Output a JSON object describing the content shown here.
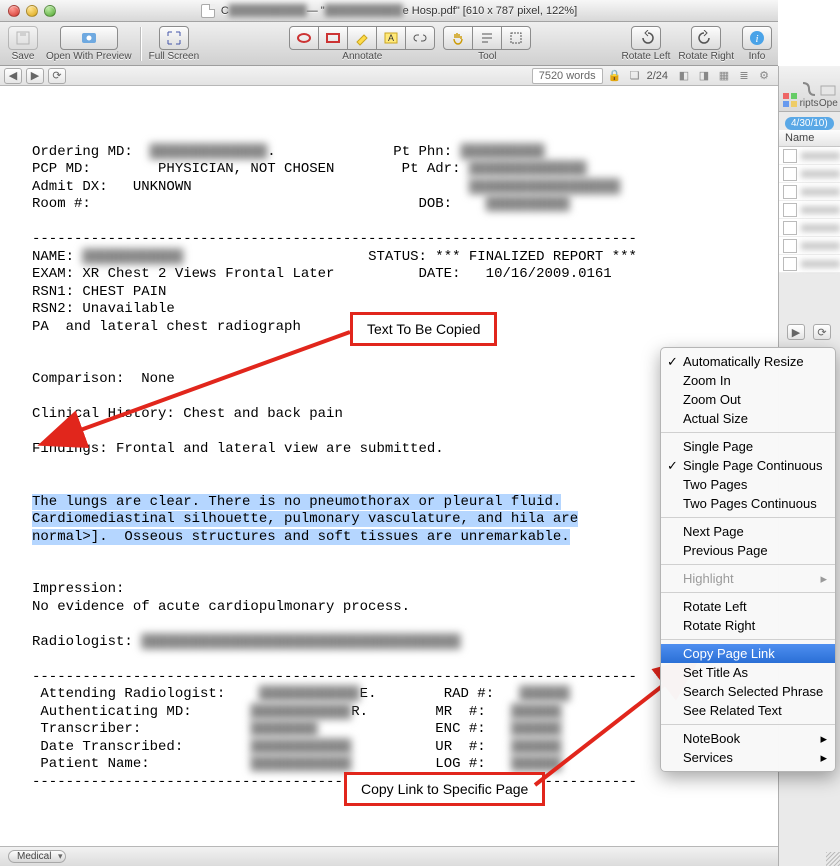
{
  "window": {
    "title_prefix": "C",
    "title_middle": " — \"",
    "title_blur": "██████████",
    "title_suffix": "e Hosp.pdf\" [610 x 787 pixel, 122%]"
  },
  "toolbar": {
    "save": "Save",
    "open_with_preview": "Open With Preview",
    "full_screen": "Full Screen",
    "annotate": "Annotate",
    "tool": "Tool",
    "rotate_left": "Rotate Left",
    "rotate_right": "Rotate Right",
    "info": "Info"
  },
  "statusbar": {
    "word_count": "7520 words",
    "page": "2/24"
  },
  "callouts": {
    "text_to_copy": "Text To Be Copied",
    "copy_link": "Copy Link to Specific Page"
  },
  "bottom_tab": "Medical",
  "side": {
    "scripts": "ripts",
    "open": "Ope",
    "date": "4/30/10)",
    "name_header": "Name"
  },
  "context_menu": {
    "items": [
      {
        "label": "Automatically Resize",
        "checked": true
      },
      {
        "label": "Zoom In"
      },
      {
        "label": "Zoom Out"
      },
      {
        "label": "Actual Size"
      },
      {
        "sep": true
      },
      {
        "label": "Single Page"
      },
      {
        "label": "Single Page Continuous",
        "checked": true
      },
      {
        "label": "Two Pages"
      },
      {
        "label": "Two Pages Continuous"
      },
      {
        "sep": true
      },
      {
        "label": "Next Page"
      },
      {
        "label": "Previous Page"
      },
      {
        "sep": true
      },
      {
        "label": "Highlight",
        "dim": true,
        "sub": true
      },
      {
        "sep": true
      },
      {
        "label": "Rotate Left"
      },
      {
        "label": "Rotate Right"
      },
      {
        "sep": true
      },
      {
        "label": "Copy Page Link",
        "selected": true
      },
      {
        "label": "Set Title As"
      },
      {
        "label": "Search Selected Phrase"
      },
      {
        "label": "See Related Text"
      },
      {
        "sep": true
      },
      {
        "label": "NoteBook",
        "sub": true
      },
      {
        "label": "Services",
        "sub": true
      }
    ]
  },
  "doc": {
    "ordering_md": "Ordering MD:",
    "pcp_md": "PCP MD:        PHYSICIAN, NOT CHOSEN",
    "admit_dx": "Admit DX:   UNKNOWN",
    "room": "Room #:",
    "pt_phn": "Pt Phn:",
    "pt_adr": "Pt Adr:",
    "dob": "DOB:",
    "dashes": "------------------------------------------------------------------------",
    "name": "NAME:",
    "exam": "EXAM: XR Chest 2 Views Frontal Later",
    "rsn1": "RSN1: CHEST PAIN",
    "rsn2": "RSN2: Unavailable",
    "pa": "PA  and lateral chest radiograph",
    "status": "STATUS: *** FINALIZED REPORT ***",
    "date": "DATE:   10/16/2009.0161",
    "comparison": "Comparison:  None",
    "clinical": "Clinical History: Chest and back pain",
    "findings": "Findings: Frontal and lateral view are submitted.",
    "sel1": "The lungs are clear. There is no pneumothorax or pleural fluid.",
    "sel2": "Cardiomediastinal silhouette, pulmonary vasculature, and hila are",
    "sel3": "normal>].",
    "sel3b": "  Osseous structures and soft tissues are unremarkable.",
    "impression1": "Impression:",
    "impression2": "No evidence of acute cardiopulmonary process.",
    "radiologist": "Radiologist:",
    "att_rad": " Attending Radiologist:",
    "auth_md": " Authenticating MD:",
    "trans": " Transcriber:",
    "date_tr": " Date Transcribed:",
    "pat_name": " Patient Name:",
    "rad_no": "RAD #:",
    "mr_no": "MR  #:",
    "enc_no": "ENC #:",
    "ur_no": "UR  #:",
    "log_no": "LOG #:",
    "E": "E.",
    "R": "R."
  }
}
